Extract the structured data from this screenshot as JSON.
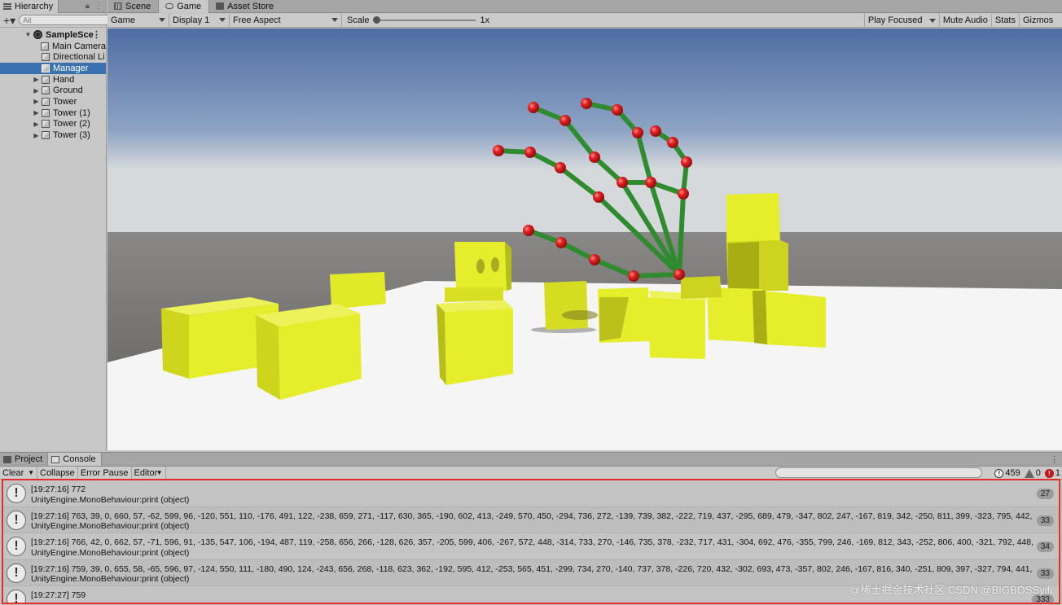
{
  "hierarchy": {
    "tab_label": "Hierarchy",
    "add_label": "+▾",
    "search_placeholder": "All",
    "scene_name": "SampleSce",
    "items": [
      {
        "label": "Main Camera",
        "expandable": false
      },
      {
        "label": "Directional Li",
        "expandable": false
      },
      {
        "label": "Manager",
        "expandable": false,
        "selected": true
      },
      {
        "label": "Hand",
        "expandable": true
      },
      {
        "label": "Ground",
        "expandable": true
      },
      {
        "label": "Tower",
        "expandable": true
      },
      {
        "label": "Tower (1)",
        "expandable": true
      },
      {
        "label": "Tower (2)",
        "expandable": true
      },
      {
        "label": "Tower (3)",
        "expandable": true
      }
    ]
  },
  "view_tabs": {
    "scene": "Scene",
    "game": "Game",
    "asset_store": "Asset Store"
  },
  "game_toolbar": {
    "mode": "Game",
    "display": "Display 1",
    "aspect": "Free Aspect",
    "scale_label": "Scale",
    "scale_value": "1x",
    "play_focused": "Play Focused",
    "mute_audio": "Mute Audio",
    "stats": "Stats",
    "gizmos": "Gizmos"
  },
  "console": {
    "tabs": {
      "project": "Project",
      "console": "Console"
    },
    "toolbar": {
      "clear": "Clear",
      "collapse": "Collapse",
      "error_pause": "Error Pause",
      "editor": "Editor"
    },
    "counts": {
      "info": "459",
      "warning": "0",
      "error": "1"
    },
    "logs": [
      {
        "line1": "[19:27:16] 772",
        "line2": "UnityEngine.MonoBehaviour:print (object)",
        "count": "27"
      },
      {
        "line1": "[19:27:16] 763, 39, 0, 660, 57, -62, 599, 96, -120, 551, 110, -176, 491, 122, -238, 659, 271, -117, 630, 365, -190, 602, 413, -249, 570, 450, -294, 736, 272, -139, 739, 382, -222, 719, 437, -295, 689, 479, -347, 802, 247, -167, 819, 342, -250, 811, 399, -323, 795, 442,",
        "line2": "UnityEngine.MonoBehaviour:print (object)",
        "count": "33"
      },
      {
        "line1": "[19:27:16] 766, 42, 0, 662, 57, -71, 596, 91, -135, 547, 106, -194, 487, 119, -258, 656, 266, -128, 626, 357, -205, 599, 406, -267, 572, 448, -314, 733, 270, -146, 735, 378, -232, 717, 431, -304, 692, 476, -355, 799, 246, -169, 812, 343, -252, 806, 400, -321, 792, 448,",
        "line2": "UnityEngine.MonoBehaviour:print (object)",
        "count": "34"
      },
      {
        "line1": "[19:27:16] 759, 39, 0, 655, 58, -65, 596, 97, -124, 550, 111, -180, 490, 124, -243, 656, 268, -118, 623, 362, -192, 595, 412, -253, 565, 451, -299, 734, 270, -140, 737, 378, -226, 720, 432, -302, 693, 473, -357, 802, 246, -167, 816, 340, -251, 809, 397, -327, 794, 441,",
        "line2": "UnityEngine.MonoBehaviour:print (object)",
        "count": "33"
      },
      {
        "line1": "[19:27:27] 759",
        "line2": "",
        "count": "333"
      }
    ]
  },
  "watermark": "@稀土掘金技术社区 CSDN @BIGBOSSyifi",
  "colors": {
    "selection": "#3a72b0",
    "highlight_border": "#e0302a",
    "cube": "#e6ee2c",
    "joint": "#d91f1f",
    "bone": "#2e8b2e"
  }
}
